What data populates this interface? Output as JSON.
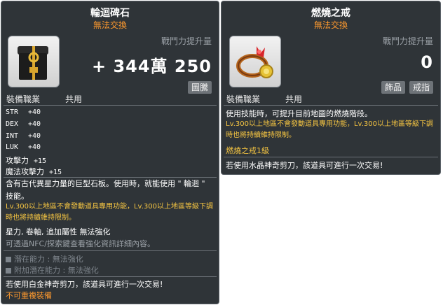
{
  "left": {
    "title": "輪迴碑石",
    "trade": "無法交換",
    "power_label": "戰鬥力提升量",
    "power_value": "+ 344萬 250",
    "category": "圖騰",
    "job_label": "裝備職業",
    "job_value": "共用",
    "stats": [
      {
        "name": "STR",
        "value": "+40"
      },
      {
        "name": "DEX",
        "value": "+40"
      },
      {
        "name": "INT",
        "value": "+40"
      },
      {
        "name": "LUK",
        "value": "+40"
      },
      {
        "name": "攻擊力",
        "value": "+15"
      },
      {
        "name": "魔法攻擊力",
        "value": "+15"
      }
    ],
    "description": "含有古代異星力量的巨型石板。使用時，就能使用 \" 輪迴 \" 技能。",
    "level_note": "Lv.300以上地區不會發動道具專用功能，Lv.300以上地區等級下調時也將持續維持限制。",
    "upgrade_info": "星力, 卷軸, 追加屬性 無法強化",
    "nfc_note": "可透過NFC/探索鍵查看強化資訊詳細內容。",
    "potential": "潛在能力 : 無法強化",
    "additional_potential": "附加潛在能力 : 無法強化",
    "scissors_note": "若使用白金神奇剪刀，該道具可進行一次交易!",
    "reequip_note": "不可重複裝備"
  },
  "right": {
    "title": "燃燒之戒",
    "trade": "無法交換",
    "power_label": "戰鬥力提升量",
    "power_value": "0",
    "category1": "飾品",
    "category2": "戒指",
    "job_label": "裝備職業",
    "job_value": "共用",
    "description": "使用技能時，可提升目前地圖的燃燒階段。",
    "level_note": "Lv.300以上地區不會發動道具專用功能，Lv.300以上地區等級下調時也將持續維持限制。",
    "ring_level": "燃燒之戒1級",
    "scissors_note": "若使用水晶神奇剪刀，該道具可進行一次交易!"
  }
}
